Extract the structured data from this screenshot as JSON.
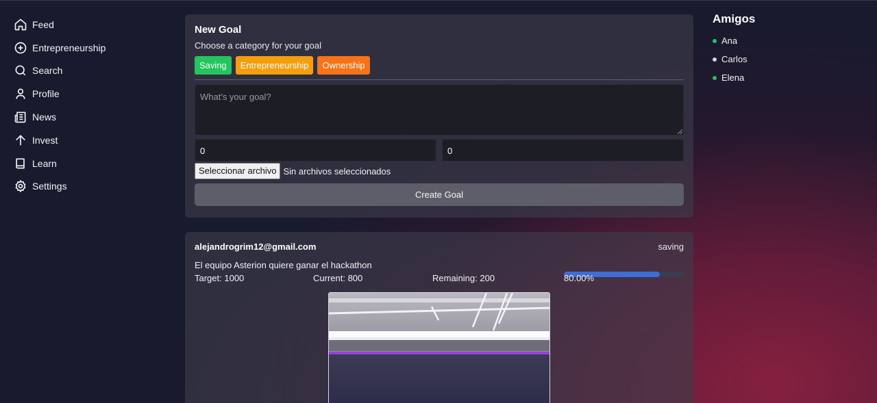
{
  "sidebar": {
    "items": [
      {
        "label": "Feed",
        "icon": "home-icon"
      },
      {
        "label": "Entrepreneurship",
        "icon": "plus-circle-icon"
      },
      {
        "label": "Search",
        "icon": "search-icon"
      },
      {
        "label": "Profile",
        "icon": "user-icon"
      },
      {
        "label": "News",
        "icon": "newspaper-icon"
      },
      {
        "label": "Invest",
        "icon": "arrow-up-icon"
      },
      {
        "label": "Learn",
        "icon": "book-icon"
      },
      {
        "label": "Settings",
        "icon": "gear-icon"
      }
    ]
  },
  "composer": {
    "title": "New Goal",
    "subtitle": "Choose a category for your goal",
    "categories": [
      {
        "label": "Saving",
        "color": "#22c55e"
      },
      {
        "label": "Entrepreneurship",
        "color": "#f59e0b"
      },
      {
        "label": "Ownership",
        "color": "#f97316"
      }
    ],
    "goal_placeholder": "What's your goal?",
    "target_value": "0",
    "current_value": "0",
    "file_button": "Seleccionar archivo",
    "file_status": "Sin archivos seleccionados",
    "submit_label": "Create Goal"
  },
  "post": {
    "user": "alejandrogrim12@gmail.com",
    "category": "saving",
    "text": "El equipo Asterion quiere ganar el hackathon",
    "target": "Target: 1000",
    "current": "Current: 800",
    "remaining": "Remaining: 200",
    "progress_label": "80.00%",
    "progress_fraction": 0.8,
    "progress_color": "#3b6fd6"
  },
  "friends": {
    "title": "Amigos",
    "list": [
      {
        "name": "Ana",
        "status_color": "#22c55e"
      },
      {
        "name": "Carlos",
        "status_color": "#d4d4dc"
      },
      {
        "name": "Elena",
        "status_color": "#22c55e"
      }
    ]
  }
}
